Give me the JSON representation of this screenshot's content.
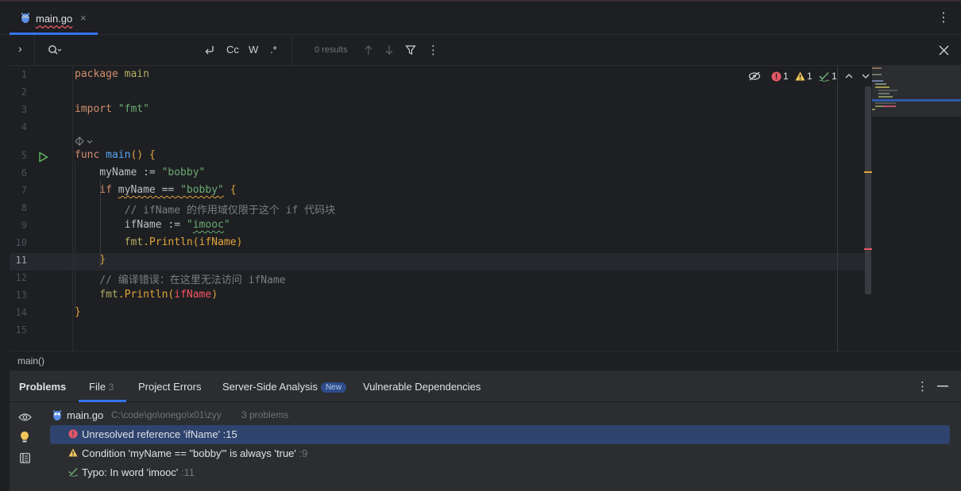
{
  "tab": {
    "filename": "main.go",
    "close": "×"
  },
  "findbar": {
    "results": "0 results",
    "case_label": "Cc",
    "word_label": "W",
    "regex_label": ".*"
  },
  "editor": {
    "line_numbers": [
      "1",
      "2",
      "3",
      "4",
      "5",
      "6",
      "7",
      "8",
      "9",
      "10",
      "11",
      "12",
      "13",
      "14",
      "15"
    ],
    "inspection": {
      "errors": "1",
      "warnings": "1",
      "typos": "1"
    },
    "code": {
      "l1_kw": "package",
      "l1_rest": " main",
      "l3_kw": "import",
      "l3_str": " \"fmt\"",
      "l5_kw": "func",
      "l5_fn": " main",
      "l5_rest": "() {",
      "l6_var": "    myName := ",
      "l6_str": "\"bobby\"",
      "l7_if": "    if ",
      "l7_cond_a": "myName == ",
      "l7_cond_b": "\"bobby\"",
      "l7_brace": " {",
      "l8": "        // ifName 的作用域仅限于这个 if 代码块",
      "l9_var": "        ifName := ",
      "l9_q1": "\"",
      "l9_typo": "imooc",
      "l9_q2": "\"",
      "l10_pkg": "        fmt",
      "l10_rest": ".Println(ifName)",
      "l11": "    }",
      "l12": "    // 编译错误：在这里无法访问 ifName",
      "l13_pkg": "    fmt",
      "l13_call": ".Println(",
      "l13_err": "ifName",
      "l13_end": ")",
      "l14": "}"
    }
  },
  "breadcrumb": {
    "text": "main()"
  },
  "problems": {
    "title": "Problems",
    "tabs": {
      "file": "File",
      "file_count": "3",
      "project_errors": "Project Errors",
      "server_side": "Server-Side Analysis",
      "new_badge": "New",
      "vulnerable": "Vulnerable Dependencies"
    },
    "file_header": {
      "name": "main.go",
      "path": "C:\\code\\go\\onego\\x01\\zyy",
      "count": "3 problems"
    },
    "items": [
      {
        "text": "Unresolved reference 'ifName'",
        "line": " :15",
        "severity": "error"
      },
      {
        "text": "Condition 'myName == \"bobby\"' is always 'true'",
        "line": " :9",
        "severity": "warning"
      },
      {
        "text": "Typo: In word 'imooc'",
        "line": " :11",
        "severity": "typo"
      }
    ]
  },
  "colors": {
    "accent": "#3574f0",
    "error": "#f75464",
    "warning": "#e0a43c",
    "ok": "#6aab73"
  }
}
